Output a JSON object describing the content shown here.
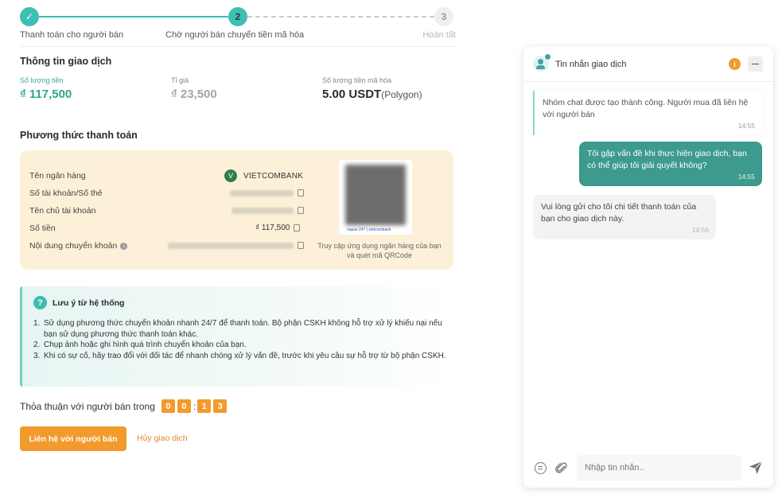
{
  "stepper": {
    "steps": [
      {
        "number": "✓",
        "label": "Thanh toán cho người bán"
      },
      {
        "number": "2",
        "label": "Chờ người bán chuyển tiền mã hóa"
      },
      {
        "number": "3",
        "label": "Hoàn tất"
      }
    ]
  },
  "transaction": {
    "title": "Thông tin giao dịch",
    "amount_label": "Số lượng tiền",
    "amount_value": "₫ 117,500",
    "rate_label": "Tỉ giá",
    "rate_value": "₫ 23,500",
    "crypto_label": "Số lượng tiền mã hóa",
    "crypto_value": "5.00 USDT",
    "crypto_network": "(Polygon)"
  },
  "payment": {
    "title": "Phương thức thanh toán",
    "bank_label": "Tên ngân hàng",
    "bank_value": "VIETCOMBANK",
    "account_label": "Số tài khoản/Số thẻ",
    "owner_label": "Tên chủ tài khoản",
    "amount_label": "Số tiền",
    "amount_value": "₫ 117,500",
    "content_label": "Nội dung chuyển khoản",
    "qr_footer": "napas 247 | vietcombank",
    "qr_hint": "Truy cập ứng dụng ngân hàng của bạn và quét mã QRCode"
  },
  "notice": {
    "title": "Lưu ý từ hệ thống",
    "items": [
      {
        "n": "1.",
        "text": "Sử dụng phương thức chuyển khoản nhanh 24/7 để thanh toán. Bộ phận CSKH không hỗ trợ xử lý khiếu nại nếu bạn sử dụng phương thức thanh toán khác."
      },
      {
        "n": "2.",
        "text": "Chụp ảnh hoặc ghi hình quá trình chuyển khoản của bạn."
      },
      {
        "n": "3.",
        "text": "Khi có sự cố, hãy trao đổi với đối tác để nhanh chóng xử lý vấn đề, trước khi yêu cầu sự hỗ trợ từ bộ phận CSKH."
      }
    ]
  },
  "timer": {
    "label": "Thỏa thuận với người bán trong",
    "digits": [
      "0",
      "0",
      "1",
      "3"
    ]
  },
  "actions": {
    "contact_label": "Liên hệ với người bán",
    "cancel_label": "Hủy giao dịch"
  },
  "colors": {
    "accent": "#3dbfb4",
    "orange": "#f29a2c",
    "card_bg": "#fcf1d8",
    "outgoing_bubble": "#3d9a8d"
  },
  "chat": {
    "title": "Tin nhắn giao dịch",
    "info_badge": "i",
    "messages": [
      {
        "type": "system",
        "text": "Nhóm chat được tạo thành công. Người mua đã liên hệ với người bán",
        "time": "14:55"
      },
      {
        "type": "outgoing",
        "text": "Tôi gặp vấn đề khi thực hiện giao dịch, bạn có thể giúp tôi giải quyết không?",
        "time": "14:55"
      },
      {
        "type": "incoming",
        "text": "Vui lòng gửi cho tôi chi tiết thanh toán của bạn cho giao dịch này.",
        "time": "14:56"
      }
    ],
    "input_placeholder": "Nhập tin nhắn.."
  },
  "icons": [
    "check-icon",
    "vietcombank-logo",
    "copy-icon",
    "info-icon",
    "question-icon",
    "chat-user-icon",
    "minimize-icon",
    "emoji-icon",
    "paperclip-icon",
    "send-icon"
  ]
}
